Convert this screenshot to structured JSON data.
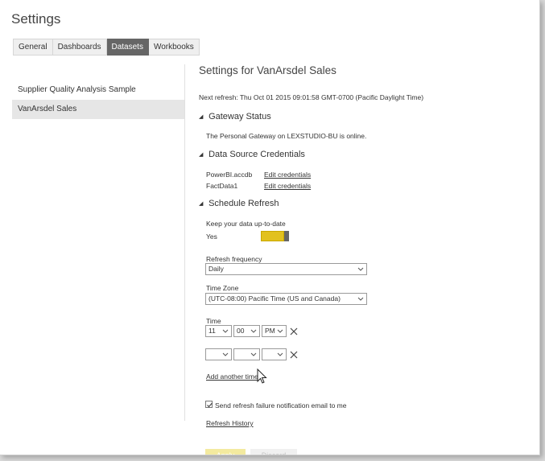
{
  "window": {
    "title": "Settings"
  },
  "tabs": [
    {
      "label": "General"
    },
    {
      "label": "Dashboards"
    },
    {
      "label": "Datasets",
      "active": true
    },
    {
      "label": "Workbooks"
    }
  ],
  "sidebar": {
    "items": [
      {
        "label": "Supplier Quality Analysis Sample"
      },
      {
        "label": "VanArsdel Sales",
        "selected": true
      }
    ]
  },
  "main": {
    "title": "Settings for VanArsdel Sales",
    "next_refresh": "Next refresh: Thu Oct 01 2015 09:01:58 GMT-0700 (Pacific Daylight Time)",
    "gateway": {
      "heading": "Gateway Status",
      "status": "The Personal Gateway on LEXSTUDIO-BU is online."
    },
    "credentials": {
      "heading": "Data Source Credentials",
      "sources": [
        {
          "name": "PowerBI.accdb",
          "action": "Edit credentials"
        },
        {
          "name": "FactData1",
          "action": "Edit credentials"
        }
      ]
    },
    "schedule": {
      "heading": "Schedule Refresh",
      "keep_label": "Keep your data up-to-date",
      "keep_value": "Yes",
      "toggle_on": true,
      "toggle_color": "#e2c11e",
      "frequency_label": "Refresh frequency",
      "frequency_value": "Daily",
      "timezone_label": "Time Zone",
      "timezone_value": "(UTC-08:00) Pacific Time (US and Canada)",
      "time_label": "Time",
      "time_rows": [
        {
          "hour": "11",
          "minute": "00",
          "ampm": "PM"
        },
        {
          "hour": "",
          "minute": "",
          "ampm": ""
        }
      ],
      "add_time": "Add another time",
      "notify_label": "Send refresh failure notification email to me",
      "notify_checked": true,
      "history_link": "Refresh History"
    },
    "buttons": {
      "apply": "Apply",
      "discard": "Discard"
    }
  },
  "icons": {
    "collapse": "collapse-triangle-icon",
    "remove": "close-x-icon",
    "dropdown": "chevron-down-icon",
    "cursor": "pointer-cursor-icon"
  }
}
